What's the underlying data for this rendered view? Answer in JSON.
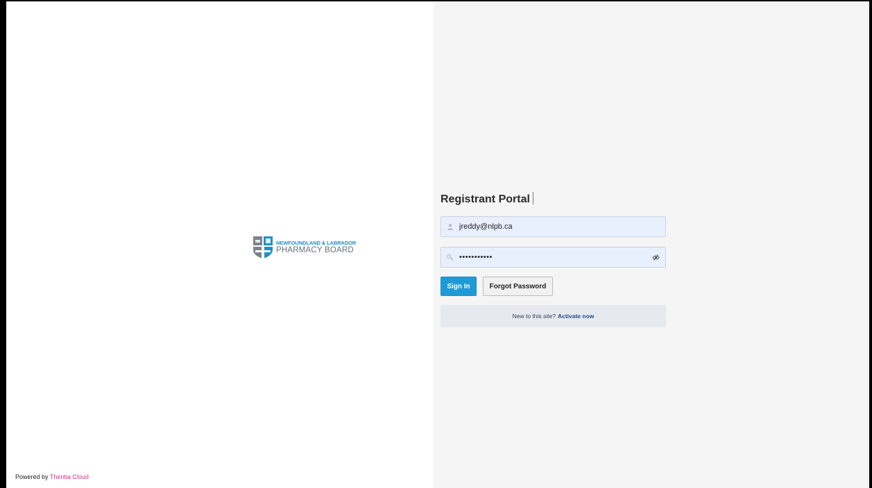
{
  "branding": {
    "logo_line1": "NEWFOUNDLAND & LABRADOR",
    "logo_line2": "PHARMACY BOARD",
    "powered_by_prefix": "Powered by",
    "powered_by_brand": "Thentia Cloud",
    "brand_color": "#d63384"
  },
  "login": {
    "title": "Registrant Portal",
    "email_value": "jreddy@nlpb.ca",
    "password_value": "•••••••••••",
    "sign_in_label": "Sign In",
    "forgot_label": "Forgot Password",
    "activate_prompt": "New to this site?",
    "activate_link": "Activate now",
    "accent_color": "#1e9bd7"
  },
  "icons": {
    "email_field": "user-icon",
    "password_field": "key-icon",
    "password_toggle": "eye-slash-icon"
  }
}
